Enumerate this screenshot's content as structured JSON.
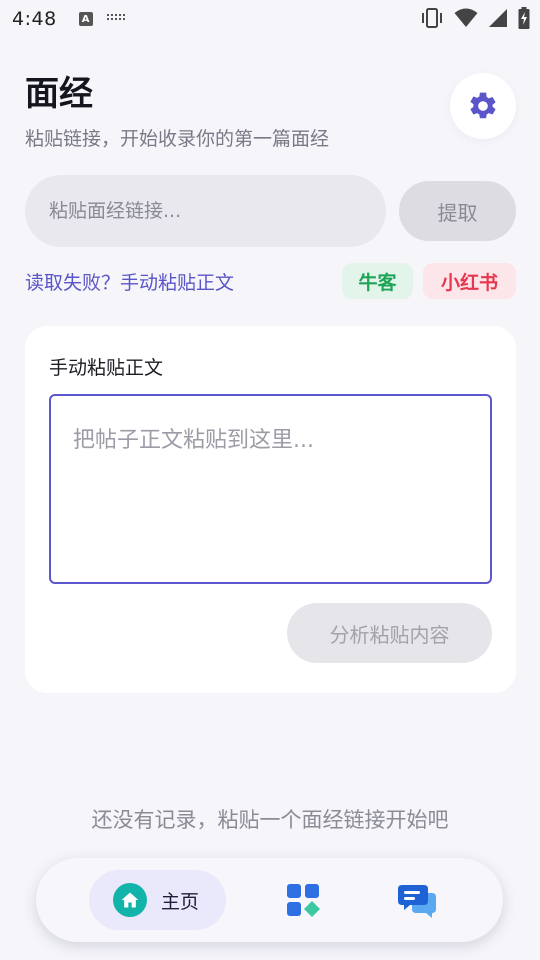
{
  "status_bar": {
    "time": "4:48",
    "icons": [
      "a-notification-icon",
      "keyboard-icon",
      "vibrate-icon",
      "wifi-icon",
      "signal-icon",
      "battery-icon"
    ]
  },
  "header": {
    "title": "面经",
    "subtitle": "粘贴链接，开始收录你的第一篇面经",
    "settings_icon": "gear-icon"
  },
  "link_input": {
    "placeholder": "粘贴面经链接...",
    "value": "",
    "extract_label": "提取"
  },
  "manual_link": "读取失败？手动粘贴正文",
  "tags": [
    {
      "label": "牛客",
      "color": "#1ea457"
    },
    {
      "label": "小红书",
      "color": "#e5384f"
    }
  ],
  "manual_card": {
    "title": "手动粘贴正文",
    "placeholder": "把帖子正文粘贴到这里...",
    "value": "",
    "analyze_label": "分析粘贴内容"
  },
  "empty_state": "还没有记录，粘贴一个面经链接开始吧",
  "bottom_nav": {
    "items": [
      {
        "label": "主页",
        "icon": "home-icon",
        "active": true
      },
      {
        "label": "",
        "icon": "apps-grid-icon",
        "active": false
      },
      {
        "label": "",
        "icon": "chat-icon",
        "active": false
      }
    ]
  },
  "colors": {
    "accent": "#5c57cc",
    "background": "#f5f5fa",
    "home_icon_bg": "#12b3a8",
    "nav_icon_blue": "#2f6fe4"
  }
}
